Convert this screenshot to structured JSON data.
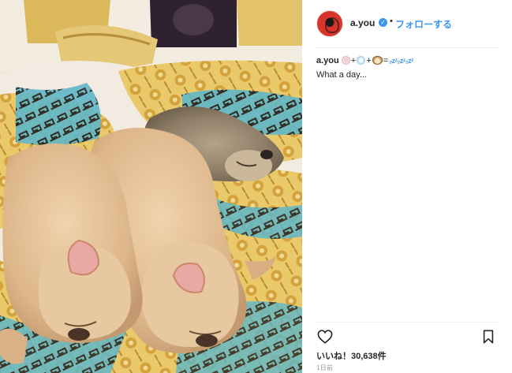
{
  "post": {
    "username": "a.you",
    "follow_label": "フォローする",
    "caption_equals": "=",
    "caption_plus": "+",
    "caption_zzz": "₂zᶻ₂zᶻ₂zᶻ",
    "caption_text": "What a day...",
    "likes": "いいね！30,638件",
    "time_ago": "1日前"
  },
  "icons": {
    "verified": "verified-badge-icon",
    "heart": "heart-icon",
    "bookmark": "bookmark-icon",
    "emoji_1": "cherry-blossom-emoji",
    "emoji_2": "snowflake-emoji",
    "emoji_3": "dog-face-emoji"
  },
  "colors": {
    "link_blue": "#3897f0",
    "text": "#262626",
    "muted": "#999999"
  }
}
